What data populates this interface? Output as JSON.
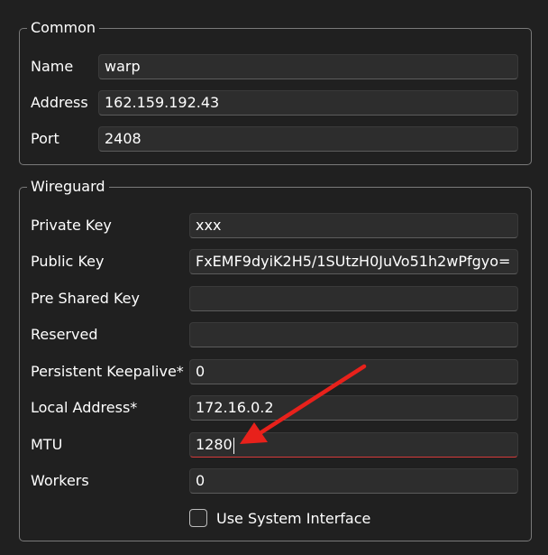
{
  "common": {
    "legend": "Common",
    "fields": [
      {
        "label": "Name",
        "value": "warp"
      },
      {
        "label": "Address",
        "value": "162.159.192.43"
      },
      {
        "label": "Port",
        "value": "2408"
      }
    ]
  },
  "wireguard": {
    "legend": "Wireguard",
    "fields": [
      {
        "label": "Private Key",
        "value": "xxx"
      },
      {
        "label": "Public Key",
        "value": "FxEMF9dyiK2H5/1SUtzH0JuVo51h2wPfgyo="
      },
      {
        "label": "Pre Shared Key",
        "value": ""
      },
      {
        "label": "Reserved",
        "value": ""
      },
      {
        "label": "Persistent Keepalive*",
        "value": "0"
      },
      {
        "label": "Local Address*",
        "value": "172.16.0.2"
      },
      {
        "label": "MTU",
        "value": "1280"
      },
      {
        "label": "Workers",
        "value": "0"
      }
    ],
    "use_system_interface": {
      "label": "Use System Interface",
      "checked": false
    }
  },
  "colors": {
    "background": "#202020",
    "input_background": "#2d2d2d",
    "focus_underline": "#d43a3a",
    "annotation_arrow": "#e8211b"
  },
  "annotation": "red-arrow-pointing-at-mtu-field"
}
